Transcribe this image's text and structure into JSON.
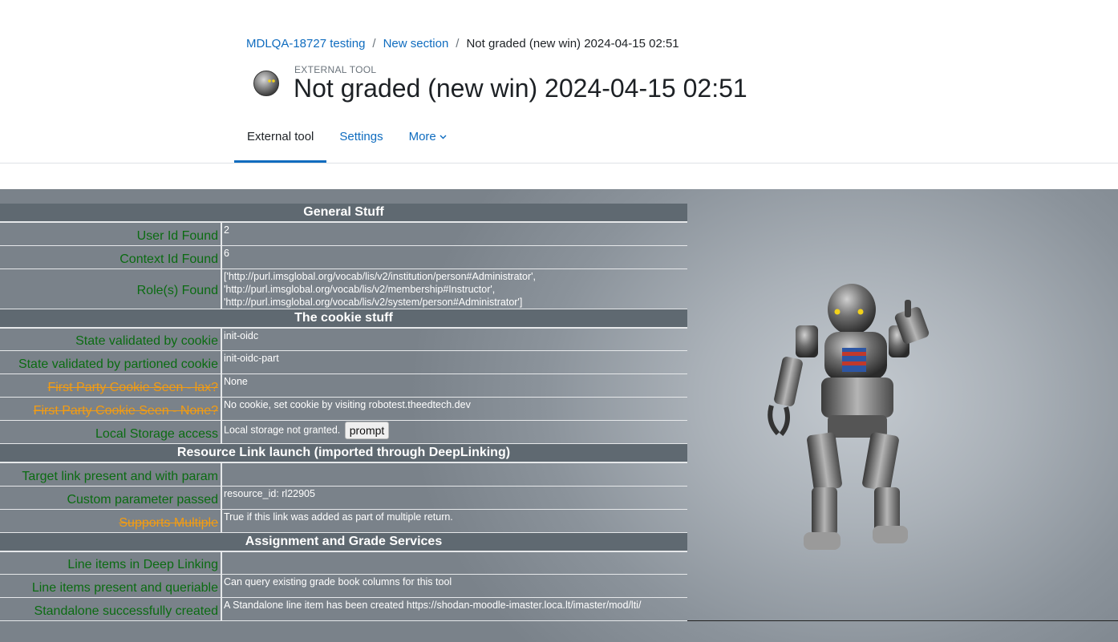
{
  "breadcrumb": {
    "items": [
      {
        "label": "MDLQA-18727 testing"
      },
      {
        "label": "New section"
      },
      {
        "label": "Not graded (new win) 2024-04-15 02:51"
      }
    ],
    "separator": "/"
  },
  "activity": {
    "type_label": "EXTERNAL TOOL",
    "title": "Not graded (new win) 2024-04-15 02:51",
    "icon": "robot-head-icon"
  },
  "tabs": [
    {
      "label": "External tool",
      "active": true
    },
    {
      "label": "Settings",
      "active": false
    },
    {
      "label": "More",
      "active": false,
      "icon": "chevron-down-icon"
    }
  ],
  "tool": {
    "sections": [
      {
        "title": "General Stuff",
        "rows": [
          {
            "label": "User Id Found",
            "value": "2",
            "status": "ok"
          },
          {
            "label": "Context Id Found",
            "value": "6",
            "status": "ok"
          },
          {
            "label": "Role(s) Found",
            "value": "['http://purl.imsglobal.org/vocab/lis/v2/institution/person#Administrator', 'http://purl.imsglobal.org/vocab/lis/v2/membership#Instructor', 'http://purl.imsglobal.org/vocab/lis/v2/system/person#Administrator']",
            "status": "ok"
          }
        ]
      },
      {
        "title": "The cookie stuff",
        "rows": [
          {
            "label": "State validated by cookie",
            "value": "init-oidc",
            "status": "ok"
          },
          {
            "label": "State validated by partioned cookie",
            "value": "init-oidc-part",
            "status": "ok"
          },
          {
            "label": "First Party Cookie Seen - lax?",
            "value": "None",
            "status": "warn"
          },
          {
            "label": "First Party Cookie Seen - None?",
            "value": "No cookie, set cookie by visiting robotest.theedtech.dev",
            "status": "warn"
          },
          {
            "label": "Local Storage access",
            "value": "Local storage not granted.",
            "button": "prompt",
            "status": "ok"
          }
        ]
      },
      {
        "title": "Resource Link launch (imported through DeepLinking)",
        "rows": [
          {
            "label": "Target link present and with param",
            "value": "",
            "status": "ok"
          },
          {
            "label": "Custom parameter passed",
            "value": "resource_id: rl22905",
            "status": "ok"
          },
          {
            "label": "Supports Multiple",
            "value": "True if this link was added as part of multiple return.",
            "status": "warn"
          }
        ]
      },
      {
        "title": "Assignment and Grade Services",
        "rows": [
          {
            "label": "Line items in Deep Linking",
            "value": "",
            "status": "ok"
          },
          {
            "label": "Line items present and queriable",
            "value": "Can query existing grade book columns for this tool",
            "status": "ok"
          },
          {
            "label": "Standalone successfully created",
            "value": "A Standalone line item has been created https://shodan-moodle-imaster.loca.lt/imaster/mod/lti/",
            "status": "ok"
          }
        ]
      }
    ]
  },
  "colors": {
    "link": "#0f6cbf",
    "ok_label": "#0b6b12",
    "warn_label": "#f39c12",
    "section_bg": "#5f6971"
  }
}
